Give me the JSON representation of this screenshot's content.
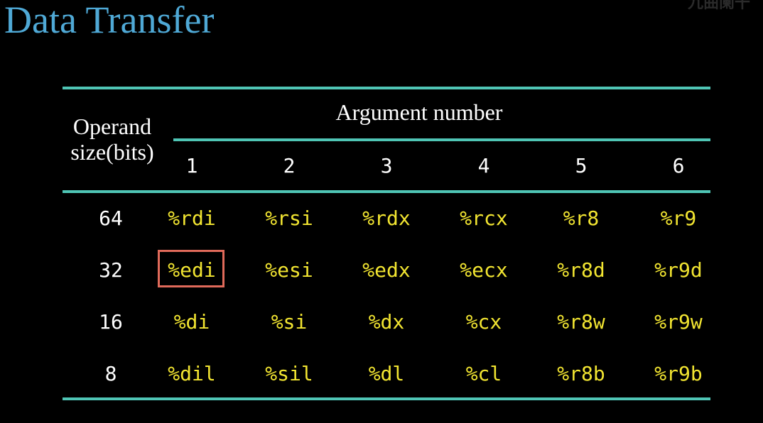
{
  "slide": {
    "title": "Data Transfer",
    "watermark": "九曲阑干"
  },
  "table": {
    "operand_header": "Operand size(bits)",
    "argument_header": "Argument number",
    "argument_numbers": [
      "1",
      "2",
      "3",
      "4",
      "5",
      "6"
    ],
    "rows": [
      {
        "size": "64",
        "registers": [
          "%rdi",
          "%rsi",
          "%rdx",
          "%rcx",
          "%r8",
          "%r9"
        ]
      },
      {
        "size": "32",
        "registers": [
          "%edi",
          "%esi",
          "%edx",
          "%ecx",
          "%r8d",
          "%r9d"
        ]
      },
      {
        "size": "16",
        "registers": [
          "%di",
          "%si",
          "%dx",
          "%cx",
          "%r8w",
          "%r9w"
        ]
      },
      {
        "size": "8",
        "registers": [
          "%dil",
          "%sil",
          "%dl",
          "%cl",
          "%r8b",
          "%r9b"
        ]
      }
    ],
    "highlighted_cell": {
      "row": 1,
      "column": 0,
      "value": "%edi"
    }
  },
  "colors": {
    "background": "#000000",
    "title": "#4fa9d6",
    "rules": "#4fc5b5",
    "register_text": "#f2e531",
    "header_text": "#ffffff",
    "highlight_border": "#e06a5a"
  }
}
